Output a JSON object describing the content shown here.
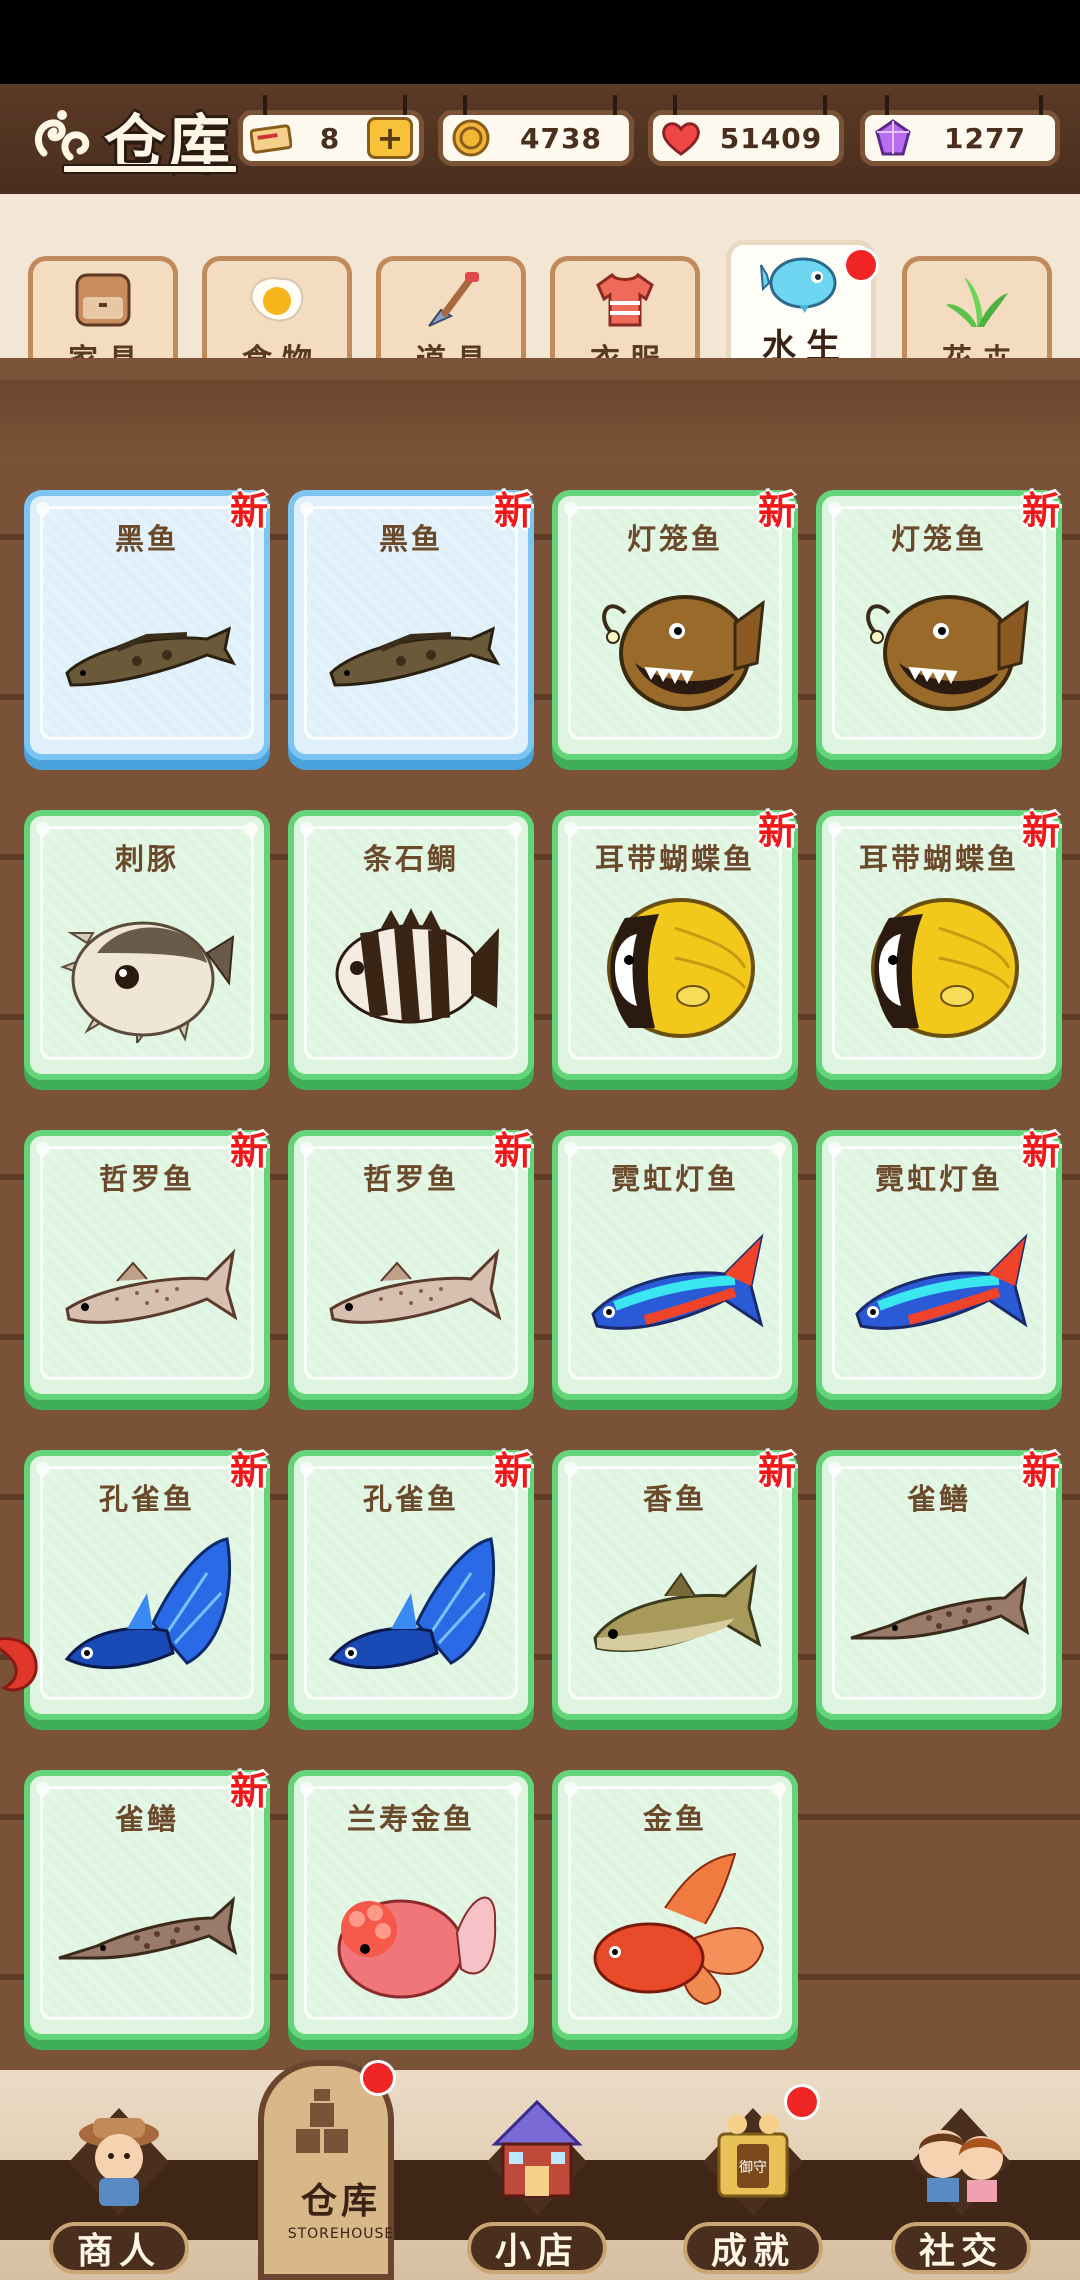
{
  "header": {
    "title": "仓库",
    "resources": [
      {
        "name": "ticket",
        "value": "8",
        "icon": "ticket-icon",
        "has_plus": true
      },
      {
        "name": "coin",
        "value": "4738",
        "icon": "coin-icon"
      },
      {
        "name": "heart",
        "value": "51409",
        "icon": "heart-icon"
      },
      {
        "name": "gem",
        "value": "1277",
        "icon": "gem-icon"
      }
    ]
  },
  "tabs": [
    {
      "label": "家具",
      "icon": "cabinet-icon",
      "active": false
    },
    {
      "label": "食物",
      "icon": "fried-egg-icon",
      "active": false
    },
    {
      "label": "道具",
      "icon": "shovel-icon",
      "active": false
    },
    {
      "label": "衣服",
      "icon": "shirt-icon",
      "active": false
    },
    {
      "label": "水生",
      "icon": "fish-icon",
      "active": true,
      "red_dot": true
    },
    {
      "label": "花卉",
      "icon": "plant-icon",
      "active": false
    }
  ],
  "items": [
    {
      "name": "黑鱼",
      "new": "新",
      "style": "blue",
      "fish": "snakehead"
    },
    {
      "name": "黑鱼",
      "new": "新",
      "style": "blue",
      "fish": "snakehead"
    },
    {
      "name": "灯笼鱼",
      "new": "新",
      "style": "green",
      "fish": "anglerfish"
    },
    {
      "name": "灯笼鱼",
      "new": "新",
      "style": "green",
      "fish": "anglerfish"
    },
    {
      "name": "刺豚",
      "new": "",
      "style": "green",
      "fish": "pufferfish"
    },
    {
      "name": "条石鲷",
      "new": "",
      "style": "green",
      "fish": "striped-beakfish"
    },
    {
      "name": "耳带蝴蝶鱼",
      "new": "新",
      "style": "green",
      "fish": "butterflyfish"
    },
    {
      "name": "耳带蝴蝶鱼",
      "new": "新",
      "style": "green",
      "fish": "butterflyfish"
    },
    {
      "name": "哲罗鱼",
      "new": "新",
      "style": "green",
      "fish": "taimen"
    },
    {
      "name": "哲罗鱼",
      "new": "新",
      "style": "green",
      "fish": "taimen"
    },
    {
      "name": "霓虹灯鱼",
      "new": "",
      "style": "green",
      "fish": "neon-tetra"
    },
    {
      "name": "霓虹灯鱼",
      "new": "新",
      "style": "green",
      "fish": "neon-tetra"
    },
    {
      "name": "孔雀鱼",
      "new": "新",
      "style": "green",
      "fish": "guppy"
    },
    {
      "name": "孔雀鱼",
      "new": "新",
      "style": "green",
      "fish": "guppy"
    },
    {
      "name": "香鱼",
      "new": "新",
      "style": "green",
      "fish": "ayu"
    },
    {
      "name": "雀鳝",
      "new": "新",
      "style": "green",
      "fish": "gar"
    },
    {
      "name": "雀鳝",
      "new": "新",
      "style": "green",
      "fish": "gar"
    },
    {
      "name": "兰寿金鱼",
      "new": "",
      "style": "green",
      "fish": "ranchu-goldfish"
    },
    {
      "name": "金鱼",
      "new": "",
      "style": "green",
      "fish": "goldfish"
    }
  ],
  "nav": [
    {
      "label": "商人",
      "icon": "merchant-icon"
    },
    {
      "label": "仓库",
      "sub": "STOREHOUSE",
      "icon": "storehouse-icon",
      "active": true,
      "red_dot": true
    },
    {
      "label": "小店",
      "icon": "shop-icon"
    },
    {
      "label": "成就",
      "icon": "achievement-icon",
      "red_dot": true
    },
    {
      "label": "社交",
      "icon": "social-icon"
    }
  ],
  "colors": {
    "card_green": "#dff5e2",
    "card_blue": "#dff0fb",
    "new_badge": "#f01818",
    "wood": "#7a5237"
  }
}
